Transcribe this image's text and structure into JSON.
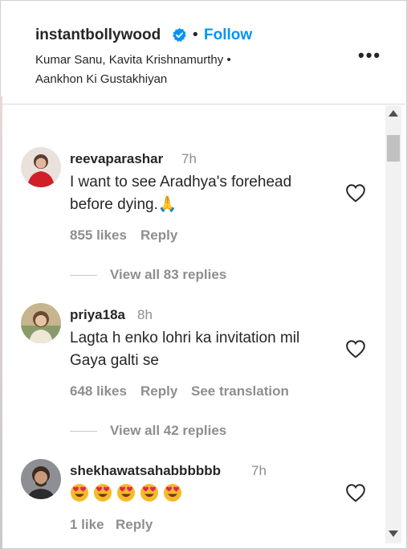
{
  "header": {
    "username": "instantbollywood",
    "separator": "•",
    "follow_label": "Follow",
    "song_line": "Kumar Sanu, Kavita Krishnamurthy • Aankhon Ki Gustakhiyan",
    "more_label": "•••"
  },
  "comments": [
    {
      "username": "reevaparashar",
      "time": "7h",
      "text": "I want to see Aradhya's forehead before dying.🙏",
      "likes": "855 likes",
      "reply_label": "Reply",
      "view_replies": "View all 83 replies"
    },
    {
      "username": "priya18a",
      "time": "8h",
      "text": "Lagta h enko lohri ka invitation mil Gaya galti se",
      "likes": "648 likes",
      "reply_label": "Reply",
      "translation_label": "See translation",
      "view_replies": "View all 42 replies"
    },
    {
      "username": "shekhawatsahabbbbbb",
      "time": "7h",
      "emoji_count": 5,
      "likes": "1 like",
      "reply_label": "Reply"
    }
  ],
  "colors": {
    "follow": "#0095f6",
    "verified": "#0095f6",
    "muted": "#8e8e8e"
  }
}
